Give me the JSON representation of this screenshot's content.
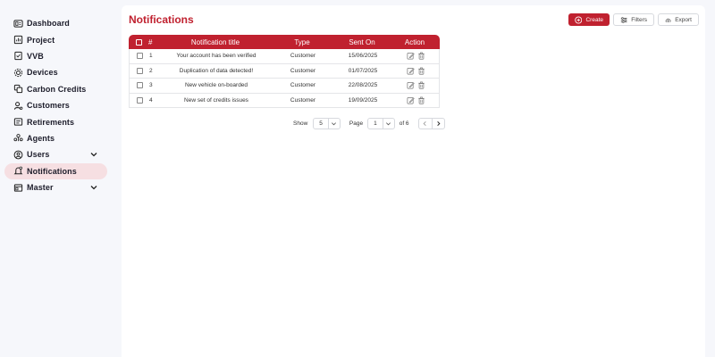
{
  "sidebar": {
    "items": [
      {
        "label": "Dashboard",
        "icon": "dashboard-icon"
      },
      {
        "label": "Project",
        "icon": "project-icon"
      },
      {
        "label": "VVB",
        "icon": "vvb-icon"
      },
      {
        "label": "Devices",
        "icon": "devices-icon"
      },
      {
        "label": "Carbon Credits",
        "icon": "carbon-credits-icon"
      },
      {
        "label": "Customers",
        "icon": "customers-icon"
      },
      {
        "label": "Retirements",
        "icon": "retirements-icon"
      },
      {
        "label": "Agents",
        "icon": "agents-icon"
      },
      {
        "label": "Users",
        "icon": "users-icon",
        "expandable": true
      },
      {
        "label": "Notifications",
        "icon": "bell-icon",
        "active": true
      },
      {
        "label": "Master",
        "icon": "master-icon",
        "expandable": true
      }
    ]
  },
  "header": {
    "title": "Notifications",
    "create_label": "Create",
    "filters_label": "Filters",
    "export_label": "Export"
  },
  "colors": {
    "accent": "#c0212f",
    "active_nav_bg": "#f6dfe2"
  },
  "table": {
    "columns": [
      "#",
      "Notification title",
      "Type",
      "Sent On",
      "Action"
    ],
    "rows": [
      {
        "num": "1",
        "title": "Your account has been verified",
        "type": "Customer",
        "sent_on": "15/06/2025"
      },
      {
        "num": "2",
        "title": "Duplication of data detected!",
        "type": "Customer",
        "sent_on": "01/07/2025"
      },
      {
        "num": "3",
        "title": "New vehicle on-boarded",
        "type": "Customer",
        "sent_on": "22/08/2025"
      },
      {
        "num": "4",
        "title": "New set of credits issues",
        "type": "Customer",
        "sent_on": "19/09/2025"
      }
    ]
  },
  "pagination": {
    "show_label": "Show",
    "page_size": "5",
    "page_label": "Page",
    "current_page": "1",
    "of_label": "of 6"
  }
}
